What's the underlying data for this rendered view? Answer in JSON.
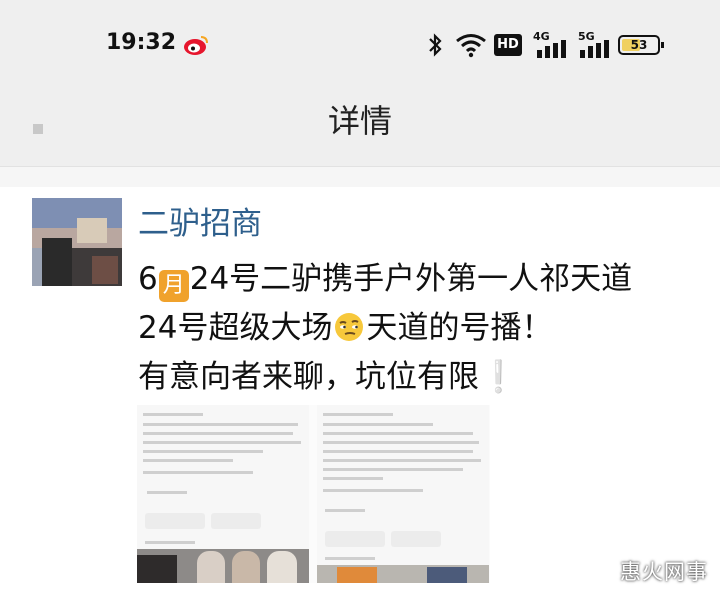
{
  "status_bar": {
    "time": "19:32",
    "battery": "53",
    "network": [
      "HD",
      "4G",
      "5G"
    ],
    "icons": [
      "weibo-icon",
      "bluetooth-icon",
      "wifi-icon",
      "hd-icon",
      "signal-4g-icon",
      "signal-5g-icon",
      "battery-icon"
    ]
  },
  "header": {
    "title": "详情",
    "back_icon": "back-icon"
  },
  "post": {
    "username": "二驴招商",
    "line1_prefix": "6",
    "line1_emoji": "月",
    "line1_suffix": "24号二驴携手户外第一人祁天道",
    "line2_prefix": "24号超级大场",
    "line2_suffix": "天道的号播！",
    "line3": "有意向者来聊，坑位有限",
    "line3_emoji": "❕"
  },
  "watermark": "惠火网事",
  "colors": {
    "username": "#2e5f8c",
    "header_bg": "#efefef",
    "accent": "#f0a22c"
  }
}
